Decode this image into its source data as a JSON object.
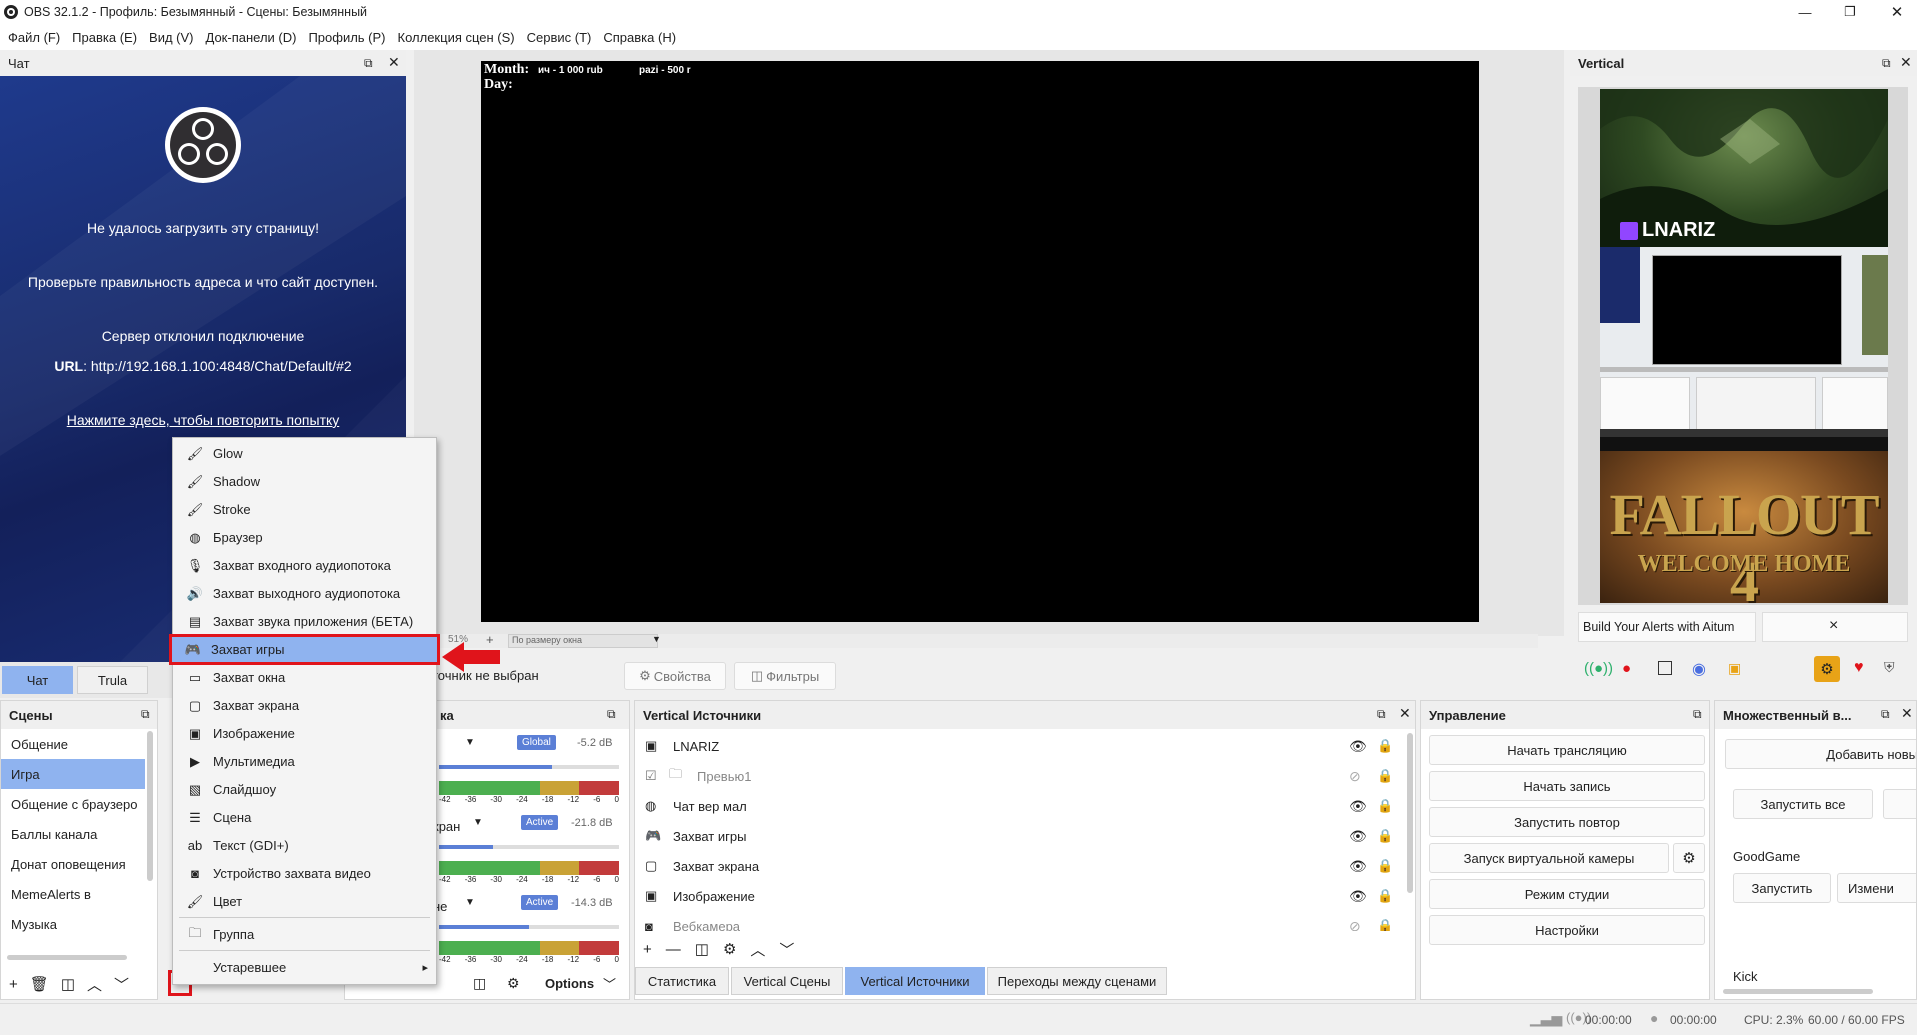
{
  "window": {
    "title": "OBS 32.1.2 - Профиль: Безымянный - Сцены: Безымянный"
  },
  "menubar": [
    "Файл (F)",
    "Правка (E)",
    "Вид (V)",
    "Док-панели (D)",
    "Профиль (P)",
    "Коллекция сцен (S)",
    "Сервис (T)",
    "Справка (H)"
  ],
  "chat": {
    "title": "Чат",
    "error": "Не удалось загрузить эту страницу!",
    "check": "Проверьте правильность адреса и что сайт доступен.",
    "refused": "Сервер отклонил подключение",
    "url_label": "URL",
    "url": ": http://192.168.1.100:4848/Chat/Default/#2",
    "retry": "Нажмите здесь, чтобы повторить попытку",
    "tabs": [
      "Чат",
      "Trula"
    ]
  },
  "preview": {
    "line1_label": "Month:",
    "line1_a": "ич - 1 000 rub",
    "line1_b": "pazi - 500 r",
    "line2_label": "Day:",
    "zoom": "51%",
    "zoom_plus": "+",
    "fit": "По размеру окна",
    "no_source": "точник не выбран",
    "properties": "Свойства",
    "filters": "Фильтры"
  },
  "vertical": {
    "title": "Vertical",
    "brand": "LNARIZ",
    "game_title": "FALLOUT 4",
    "game_sub": "WELCOME HOME",
    "alerts_text": "Build Your Alerts with Aitum",
    "close": "×"
  },
  "scenes": {
    "title": "Сцены",
    "items": [
      "Общение",
      "Игра",
      "Общение с браузеро",
      "Баллы канала",
      "Донат оповещения",
      "MemeAlerts в",
      "Музыка"
    ],
    "selected": 1
  },
  "mixer": {
    "title": "ка",
    "tracks": [
      {
        "name": "",
        "badge": "Global",
        "db": "-5.2 dB",
        "level": 0.63
      },
      {
        "name": "кран",
        "badge": "Active",
        "db": "-21.8 dB",
        "level": 0.3
      },
      {
        "name": "не",
        "badge": "Active",
        "db": "-14.3 dB",
        "level": 0.5
      }
    ],
    "ticks": [
      "-42",
      "-36",
      "-30",
      "-24",
      "-18",
      "-12",
      "-6",
      "0"
    ],
    "options": "Options"
  },
  "vsources": {
    "title": "Vertical Источники",
    "items": [
      {
        "name": "LNARIZ",
        "visible": true
      },
      {
        "name": "Превью1",
        "visible": false
      },
      {
        "name": "Чат вер мал",
        "visible": true
      },
      {
        "name": "Захват игры",
        "visible": true
      },
      {
        "name": "Захват экрана",
        "visible": true
      },
      {
        "name": "Изображение",
        "visible": true
      },
      {
        "name": "Вебкамера",
        "visible": false
      }
    ],
    "tabs": [
      "Статистика",
      "Vertical Сцены",
      "Vertical Источники",
      "Переходы между сценами"
    ]
  },
  "controls": {
    "title": "Управление",
    "buttons": [
      "Начать трансляцию",
      "Начать запись",
      "Запустить повтор",
      "Запуск виртуальной камеры",
      "Режим студии",
      "Настройки"
    ]
  },
  "multi": {
    "title": "Множественный в...",
    "add": "Добавить новы",
    "start_all": "Запустить все",
    "service1": "GoodGame",
    "start": "Запустить",
    "change": "Измени",
    "service2": "Kick"
  },
  "context_menu": {
    "items": [
      {
        "label": "Glow",
        "icon": "brush-icon"
      },
      {
        "label": "Shadow",
        "icon": "brush-icon"
      },
      {
        "label": "Stroke",
        "icon": "brush-icon"
      },
      {
        "label": "Браузер",
        "icon": "globe-icon"
      },
      {
        "label": "Захват входного аудиопотока",
        "icon": "mic-icon"
      },
      {
        "label": "Захват выходного аудиопотока",
        "icon": "speaker-icon"
      },
      {
        "label": "Захват звука приложения (БЕТА)",
        "icon": "app-audio-icon"
      },
      {
        "label": "Захват игры",
        "icon": "gamepad-icon"
      },
      {
        "label": "Захват окна",
        "icon": "window-icon"
      },
      {
        "label": "Захват экрана",
        "icon": "monitor-icon"
      },
      {
        "label": "Изображение",
        "icon": "image-icon"
      },
      {
        "label": "Мультимедиа",
        "icon": "play-icon"
      },
      {
        "label": "Слайдшоу",
        "icon": "slideshow-icon"
      },
      {
        "label": "Сцена",
        "icon": "list-icon"
      },
      {
        "label": "Текст (GDI+)",
        "icon": "text-icon"
      },
      {
        "label": "Устройство захвата видео",
        "icon": "camera-icon"
      },
      {
        "label": "Цвет",
        "icon": "brush-icon"
      },
      {
        "label": "Группа",
        "icon": "folder-icon"
      },
      {
        "label": "Устаревшее",
        "icon": ""
      }
    ],
    "highlighted": 7
  },
  "status": {
    "stream_time": "00:00:00",
    "rec_time": "00:00:00",
    "cpu": "CPU: 2.3%",
    "fps": "60.00 / 60.00 FPS"
  },
  "colors": {
    "accent": "#8fb3ef",
    "highlight_border": "#e0141b",
    "chat_bg": "#1b2b6b"
  }
}
